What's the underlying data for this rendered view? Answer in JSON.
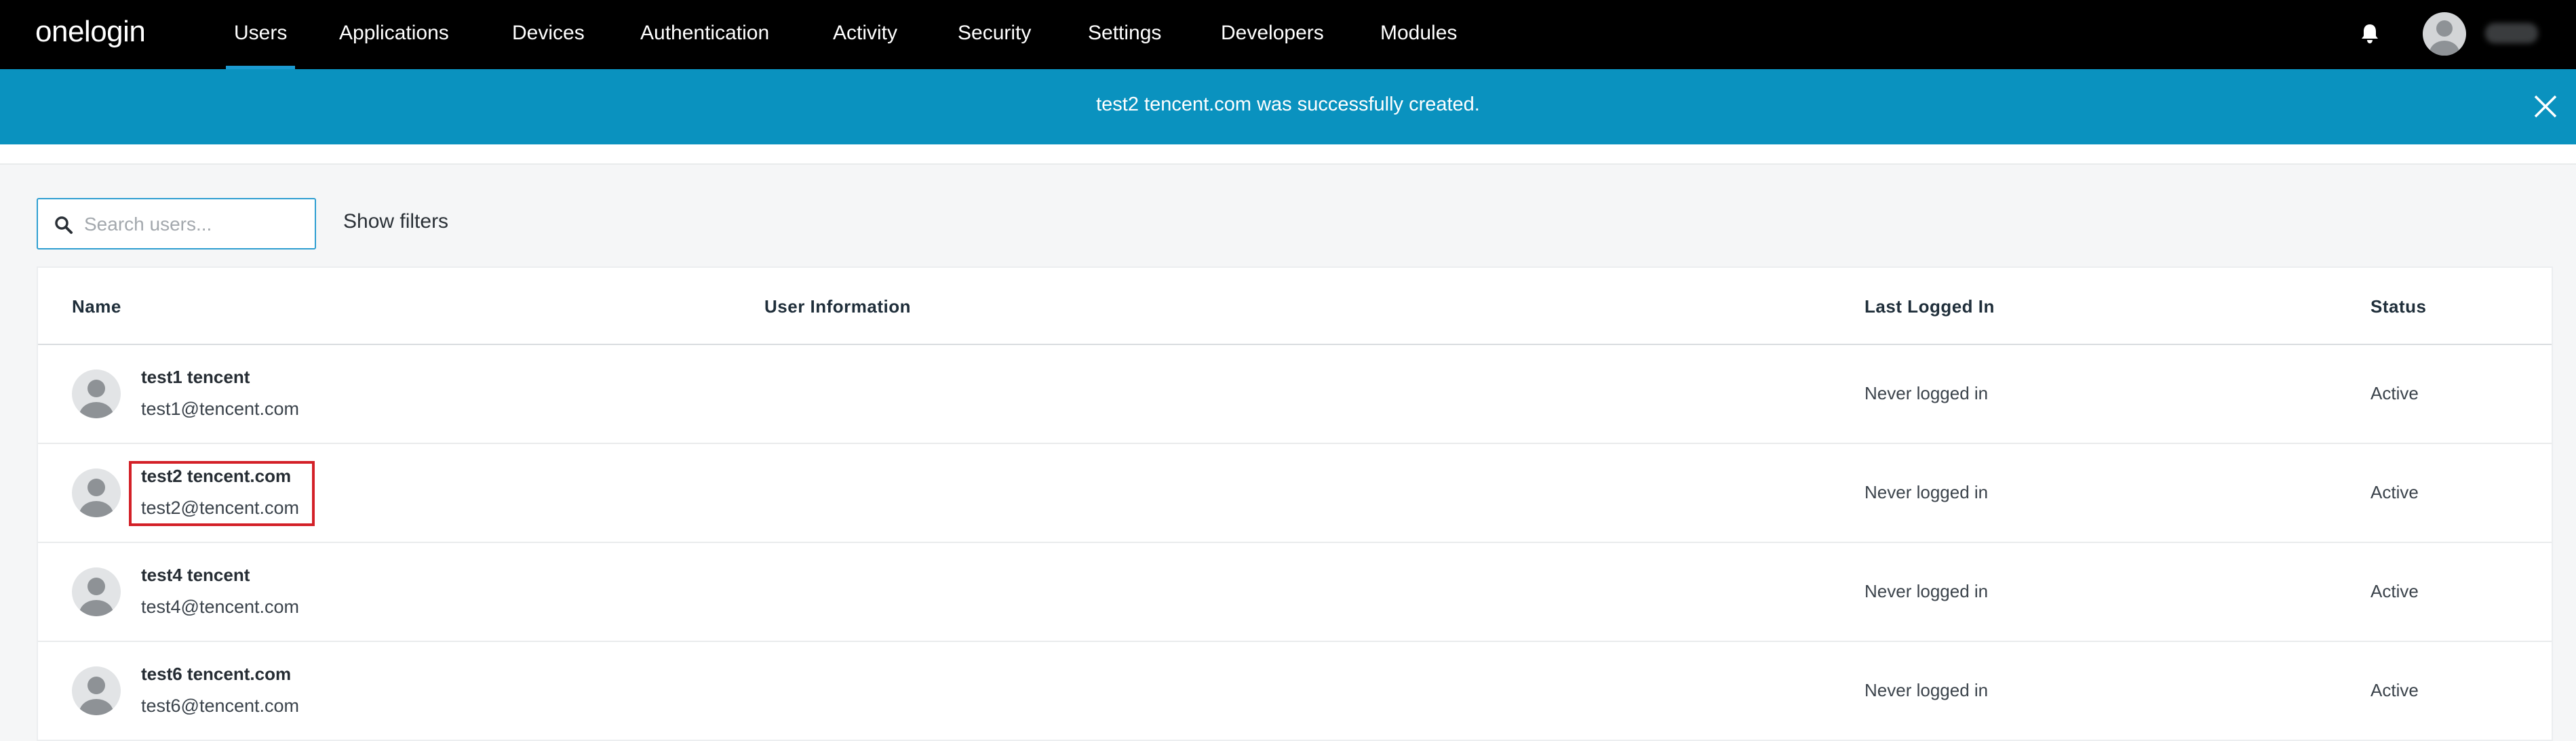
{
  "brand": {
    "logo_text": "onelogin"
  },
  "nav": {
    "items": [
      {
        "label": "Users",
        "active": true
      },
      {
        "label": "Applications"
      },
      {
        "label": "Devices"
      },
      {
        "label": "Authentication"
      },
      {
        "label": "Activity"
      },
      {
        "label": "Security"
      },
      {
        "label": "Settings"
      },
      {
        "label": "Developers"
      },
      {
        "label": "Modules"
      }
    ],
    "icons": {
      "notifications": "bell-icon",
      "user": "user-avatar-icon"
    }
  },
  "banner": {
    "message": "test2 tencent.com was successfully created.",
    "color": "#0a92bf"
  },
  "search": {
    "placeholder": "Search users...",
    "value": "",
    "show_filters_label": "Show filters"
  },
  "table": {
    "headers": {
      "name": "Name",
      "user_info": "User Information",
      "last_logged_in": "Last Logged In",
      "status": "Status"
    },
    "rows": [
      {
        "name": "test1 tencent",
        "email": "test1@tencent.com",
        "user_info": "",
        "last_logged_in": "Never logged in",
        "status": "Active"
      },
      {
        "name": "test2 tencent.com",
        "email": "test2@tencent.com",
        "user_info": "",
        "last_logged_in": "Never logged in",
        "status": "Active",
        "highlighted": true
      },
      {
        "name": "test4 tencent",
        "email": "test4@tencent.com",
        "user_info": "",
        "last_logged_in": "Never logged in",
        "status": "Active"
      },
      {
        "name": "test6 tencent.com",
        "email": "test6@tencent.com",
        "user_info": "",
        "last_logged_in": "Never logged in",
        "status": "Active"
      }
    ]
  },
  "colors": {
    "nav_background": "#000000",
    "active_tab_indicator": "#1b9ad1",
    "highlight_box": "#d32027"
  }
}
